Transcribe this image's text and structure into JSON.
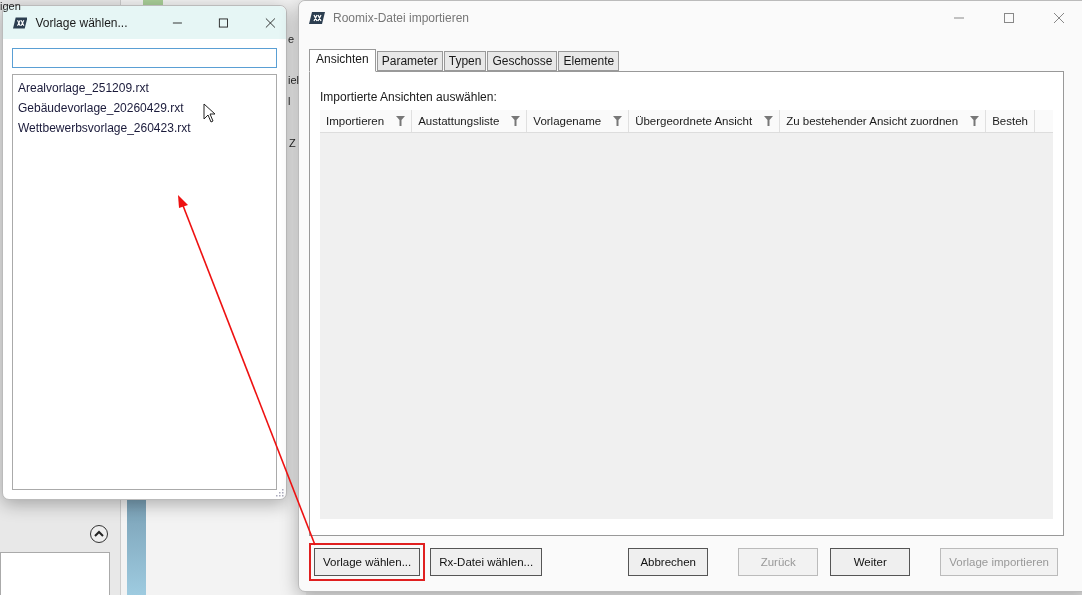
{
  "background_app": {
    "fragments": [
      "igen",
      "e",
      "iel",
      "l",
      "Z"
    ]
  },
  "chooser_window": {
    "title": "Vorlage wählen...",
    "files": [
      {
        "name": "Arealvorlage_251209.rxt"
      },
      {
        "name": "Gebäudevorlage_20260429.rxt"
      },
      {
        "name": "Wettbewerbsvorlage_260423.rxt"
      }
    ]
  },
  "import_window": {
    "title": "Roomix-Datei importieren",
    "tabs": [
      {
        "label": "Ansichten",
        "selected": true
      },
      {
        "label": "Parameter",
        "selected": false
      },
      {
        "label": "Typen",
        "selected": false
      },
      {
        "label": "Geschosse",
        "selected": false
      },
      {
        "label": "Elemente",
        "selected": false
      }
    ],
    "section_label": "Importierte Ansichten auswählen:",
    "table": {
      "columns": [
        {
          "label": "Importieren",
          "filter": true
        },
        {
          "label": "Austattungsliste",
          "filter": true
        },
        {
          "label": "Vorlagename",
          "filter": true
        },
        {
          "label": "Übergeordnete Ansicht",
          "filter": true
        },
        {
          "label": "Zu bestehender Ansicht zuordnen",
          "filter": true
        },
        {
          "label": "Besteh",
          "filter": false
        }
      ]
    },
    "buttons": [
      {
        "label": "Vorlage wählen...",
        "disabled": false,
        "highlighted": true
      },
      {
        "label": "Rx-Datei wählen...",
        "disabled": false,
        "highlighted": false
      },
      {
        "label": "Abbrechen",
        "disabled": false,
        "highlighted": false
      },
      {
        "label": "Zurück",
        "disabled": true,
        "highlighted": false
      },
      {
        "label": "Weiter",
        "disabled": false,
        "highlighted": false
      },
      {
        "label": "Vorlage importieren",
        "disabled": true,
        "highlighted": false
      }
    ]
  }
}
